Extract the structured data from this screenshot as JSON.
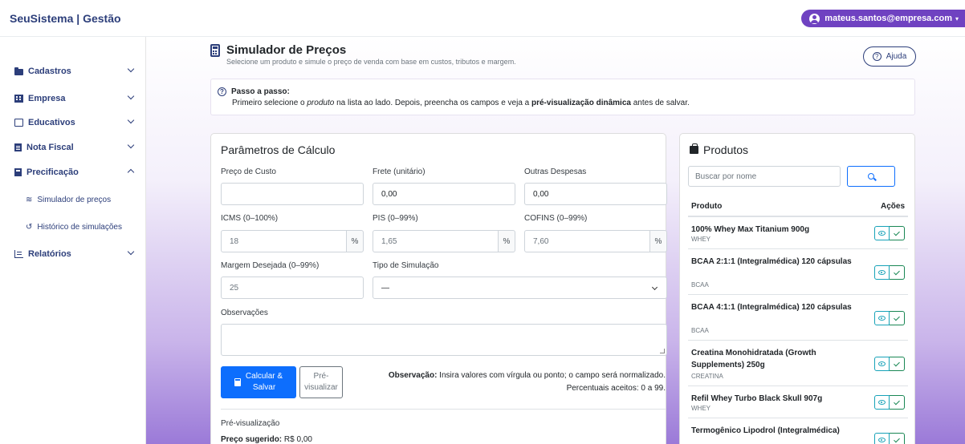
{
  "app": {
    "brand": "SeuSistema | Gestão",
    "user_email": "mateus.santos@empresa.com"
  },
  "sidebar": {
    "items": [
      {
        "label": "Cadastros"
      },
      {
        "label": "Empresa"
      },
      {
        "label": "Educativos"
      },
      {
        "label": "Nota Fiscal"
      },
      {
        "label": "Precificação"
      },
      {
        "label": "Relatórios"
      }
    ],
    "subitems": [
      {
        "label": "Simulador de preços"
      },
      {
        "label": "Histórico de simulações"
      }
    ]
  },
  "header": {
    "title": "Simulador de Preços",
    "subtitle": "Selecione um produto e simule o preço de venda com base em custos, tributos e margem.",
    "help_label": "Ajuda"
  },
  "steps": {
    "title": "Passo a passo:",
    "text_1": "Primeiro selecione o ",
    "text_em": "produto",
    "text_2": " na lista ao lado. Depois, preencha os campos e veja a ",
    "text_strong": "pré-visualização dinâmica",
    "text_3": " antes de salvar."
  },
  "params": {
    "title": "Parâmetros de Cálculo",
    "custo": {
      "label": "Preço de Custo",
      "value": ""
    },
    "frete": {
      "label": "Frete (unitário)",
      "value": "0,00"
    },
    "outras": {
      "label": "Outras Despesas",
      "value": "0,00"
    },
    "icms": {
      "label": "ICMS (0–100%)",
      "value": "18",
      "suffix": "%"
    },
    "pis": {
      "label": "PIS (0–99%)",
      "value": "1,65",
      "suffix": "%"
    },
    "cofins": {
      "label": "COFINS (0–99%)",
      "value": "7,60",
      "suffix": "%"
    },
    "margem": {
      "label": "Margem Desejada (0–99%)",
      "value": "25"
    },
    "tipo": {
      "label": "Tipo de Simulação",
      "value": "—"
    },
    "obs": {
      "label": "Observações",
      "value": ""
    },
    "btn_calc_line1": "Calcular &",
    "btn_calc_line2": "Salvar",
    "btn_prev_line1": "Pré-",
    "btn_prev_line2": "visualizar",
    "note_label": "Observação:",
    "note_text": " Insira valores com vírgula ou ponto; o campo será normalizado.",
    "note_text2": "Percentuais aceitos: 0 a 99.",
    "preview_title": "Pré-visualização",
    "preview_price_label": "Preço sugerido:",
    "preview_price_value": " R$ 0,00"
  },
  "products": {
    "title": "Produtos",
    "search_placeholder": "Buscar por nome",
    "col_product": "Produto",
    "col_actions": "Ações",
    "rows": [
      {
        "name": "100% Whey Max Titanium 900g",
        "category": "WHEY"
      },
      {
        "name": "BCAA 2:1:1 (Integralmédica) 120 cápsulas",
        "category": "BCAA"
      },
      {
        "name": "BCAA 4:1:1 (Integralmédica) 120 cápsulas",
        "category": "BCAA"
      },
      {
        "name": "Creatina Monohidratada (Growth Supplements) 250g",
        "category": "CREATINA"
      },
      {
        "name": "Refil Whey Turbo Black Skull 907g",
        "category": "WHEY"
      },
      {
        "name": "Termogênico Lipodrol (Integralmédica)",
        "category": ""
      }
    ]
  }
}
